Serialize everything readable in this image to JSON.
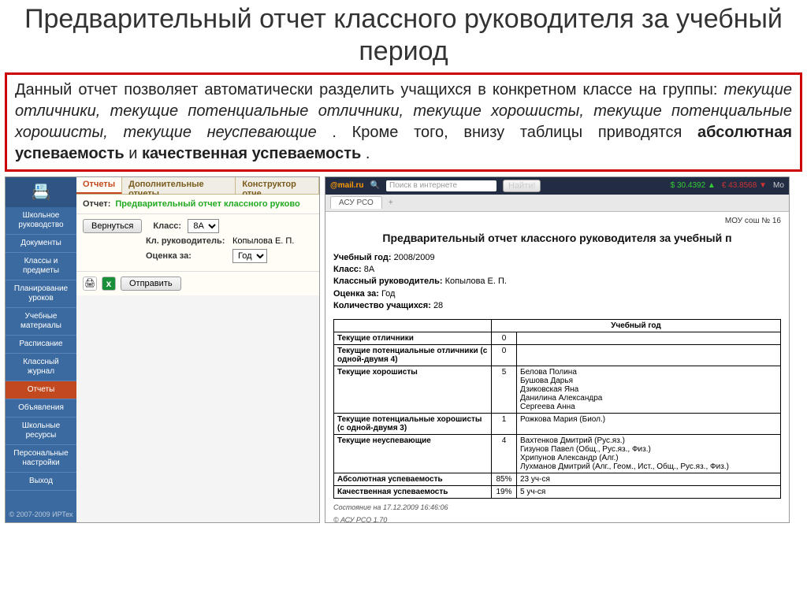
{
  "slide": {
    "title": "Предварительный отчет классного руководителя за учебный период",
    "desc_prefix": "Данный отчет позволяет автоматически разделить учащихся в конкретном классе на группы: ",
    "desc_groups": "текущие отличники, текущие потенциальные отличники, текущие хорошисты, текущие потенциальные хорошисты, текущие неуспевающие",
    "desc_middle": ". Кроме того, внизу таблицы приводятся ",
    "desc_bold1": "абсолютная успеваемость",
    "desc_and": " и ",
    "desc_bold2": "качественная успеваемость",
    "desc_end": "."
  },
  "left": {
    "tabs": {
      "t1": "Отчеты",
      "t2": "Дополнительные отчеты",
      "t3": "Конструктор отче"
    },
    "report_label": "Отчет:",
    "report_name": "Предварительный отчет классного руково",
    "back_btn": "Вернуться",
    "filters": {
      "class_label": "Класс:",
      "class_value": "8А",
      "teacher_label": "Кл. руководитель:",
      "teacher_value": "Копылова Е. П.",
      "grade_label": "Оценка за:",
      "grade_value": "Год"
    },
    "send_btn": "Отправить",
    "sidebar": {
      "items": [
        "Школьное руководство",
        "Документы",
        "Классы и предметы",
        "Планирование уроков",
        "Учебные материалы",
        "Расписание",
        "Классный журнал",
        "Отчеты",
        "Объявления",
        "Школьные ресурсы",
        "Персональные настройки",
        "Выход"
      ],
      "active_index": 7,
      "footer": "© 2007-2009 ИРТех"
    }
  },
  "right": {
    "mail_logo": "@mail.ru",
    "search_ph": "Поиск в интернете",
    "find_btn": "Найти!",
    "stock1": "$ 30.4392 ▲",
    "stock2": "€ 43.8568 ▼",
    "mo": "Мо",
    "tab": "АСУ РСО",
    "school": "МОУ сош № 16",
    "title": "Предварительный отчет классного руководителя за учебный п",
    "meta": {
      "year_l": "Учебный год:",
      "year_v": "2008/2009",
      "class_l": "Класс:",
      "class_v": "8А",
      "teacher_l": "Классный руководитель:",
      "teacher_v": "Копылова Е. П.",
      "grade_l": "Оценка за:",
      "grade_v": "Год",
      "count_l": "Количество учащихся:",
      "count_v": "28"
    },
    "th_year": "Учебный год",
    "rows": [
      {
        "label": "Текущие отличники",
        "count": "0",
        "names": ""
      },
      {
        "label": "Текущие потенциальные отличники (с одной-двумя 4)",
        "count": "0",
        "names": ""
      },
      {
        "label": "Текущие хорошисты",
        "count": "5",
        "names": "Белова Полина\nБушова Дарья\nДзиковская Яна\nДанилина Александра\nСергеева Анна"
      },
      {
        "label": "Текущие потенциальные хорошисты (с одной-двумя 3)",
        "count": "1",
        "names": "Рожкова Мария (Биол.)"
      },
      {
        "label": "Текущие неуспевающие",
        "count": "4",
        "names": "Вахтенков Дмитрий (Рус.яз.)\nГизунов Павел (Общ., Рус.яз., Физ.)\nХрипунов Александр (Алг.)\nЛухманов Дмитрий (Алг., Геом., Ист., Общ., Рус.яз., Физ.)"
      },
      {
        "label": "Абсолютная успеваемость",
        "count": "85%",
        "names": "23 уч-ся"
      },
      {
        "label": "Качественная успеваемость",
        "count": "19%",
        "names": "5 уч-ся"
      }
    ],
    "footer1": "Состояние на 17.12.2009 16:46:06",
    "footer2": "© АСУ РСО 1.70"
  }
}
